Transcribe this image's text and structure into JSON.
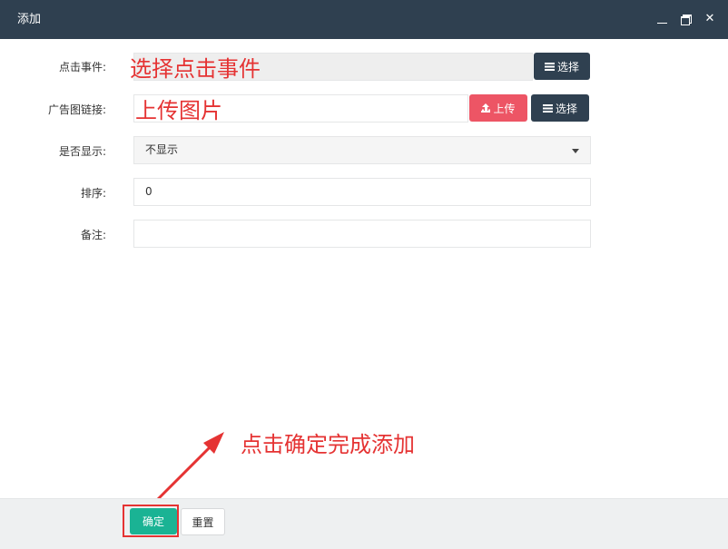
{
  "dialog": {
    "title": "添加"
  },
  "form": {
    "click_event": {
      "label": "点击事件:",
      "value": "",
      "select_label": "选择"
    },
    "ad_image": {
      "label": "广告图链接:",
      "value": "",
      "upload_label": "上传",
      "select_label": "选择"
    },
    "display": {
      "label": "是否显示:",
      "selected": "不显示"
    },
    "sort": {
      "label": "排序:",
      "value": "0"
    },
    "remark": {
      "label": "备注:",
      "value": ""
    }
  },
  "annotations": {
    "click_event_hint": "选择点击事件",
    "upload_hint": "上传图片",
    "confirm_hint": "点击确定完成添加"
  },
  "footer": {
    "confirm_label": "确定",
    "reset_label": "重置"
  },
  "colors": {
    "titlebar": "#2f4050",
    "dark_button": "#2f4050",
    "upload_button": "#ed5565",
    "confirm_button": "#1ab394",
    "annotation": "#e53333"
  },
  "icons": [
    "minimize-icon",
    "maximize-icon",
    "close-icon",
    "list-icon",
    "upload-icon",
    "dropdown-caret-icon"
  ]
}
